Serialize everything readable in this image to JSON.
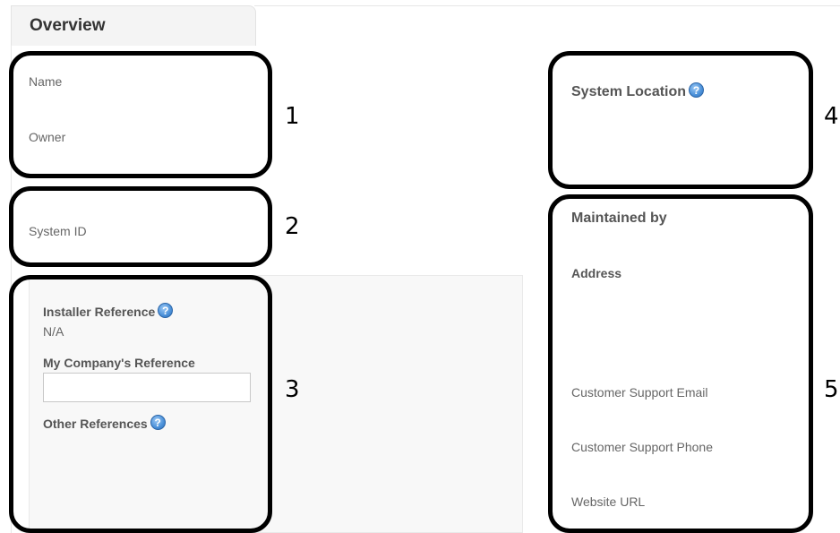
{
  "tab": {
    "title": "Overview"
  },
  "left": {
    "name_label": "Name",
    "owner_label": "Owner",
    "system_id_label": "System ID",
    "installer_reference_label": "Installer Reference",
    "installer_reference_value": "N/A",
    "my_company_reference_label": "My Company's Reference",
    "my_company_reference_value": "",
    "other_references_label": "Other References"
  },
  "right": {
    "system_location_label": "System Location",
    "maintained_by_label": "Maintained by",
    "address_label": "Address",
    "support_email_label": "Customer Support Email",
    "support_phone_label": "Customer Support Phone",
    "website_label": "Website URL"
  },
  "callouts": [
    "1",
    "2",
    "3",
    "4",
    "5"
  ],
  "icons": {
    "help": "help-question-icon"
  },
  "colors": {
    "help_icon": "#4a90d9",
    "callout_border": "#000000",
    "panel_bg": "#f8f8f8"
  }
}
